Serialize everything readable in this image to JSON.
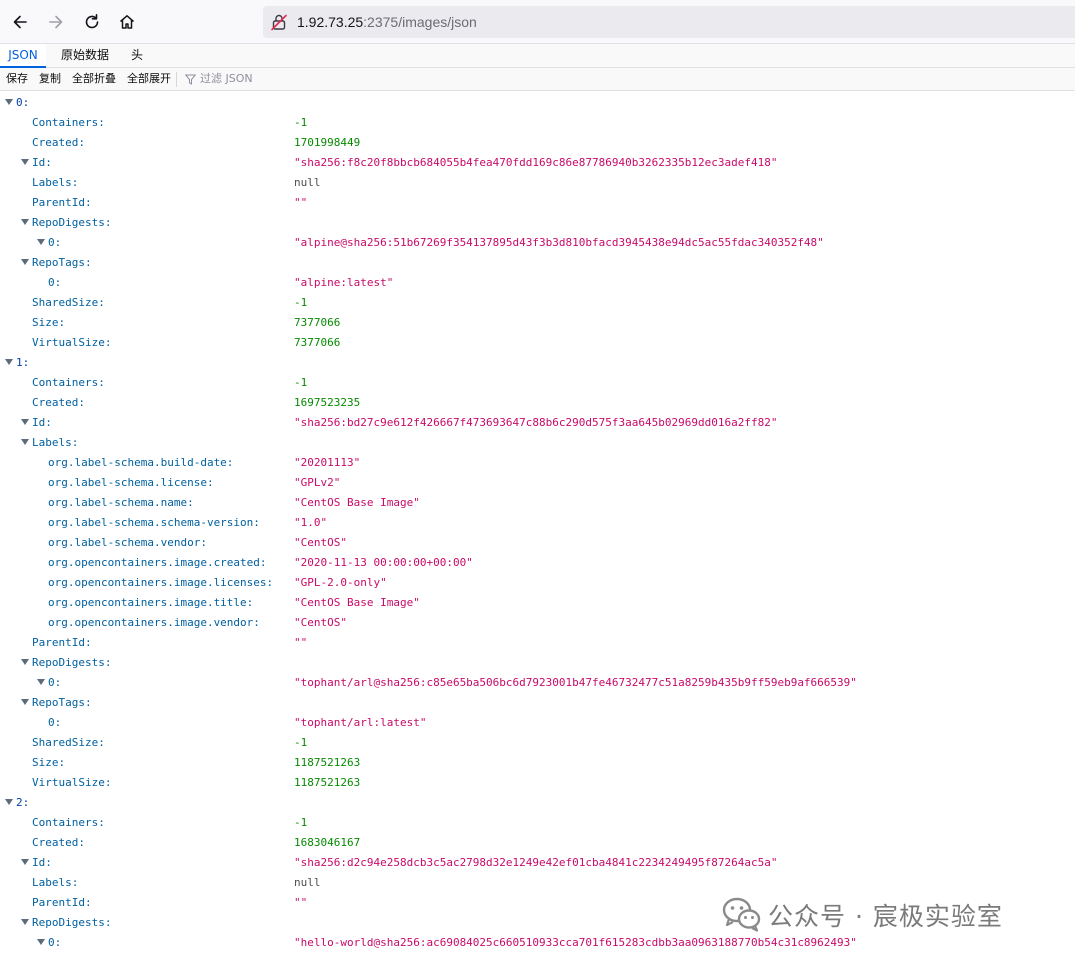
{
  "browser": {
    "url_host": "1.92.73.25",
    "url_rest": ":2375/images/json"
  },
  "viewer": {
    "tabs": [
      {
        "label": "JSON",
        "selected": true
      },
      {
        "label": "原始数据",
        "selected": false
      },
      {
        "label": "头",
        "selected": false
      }
    ],
    "toolbar": {
      "save": "保存",
      "copy": "复制",
      "collapse_all": "全部折叠",
      "expand_all": "全部展开",
      "filter_placeholder": "过滤 JSON"
    }
  },
  "colors": {
    "key": "#0060a0",
    "string": "#c80a68",
    "number": "#058b00",
    "null": "#4d4d4d",
    "accent": "#0060df"
  },
  "tree": [
    {
      "key": "0:",
      "level": 0,
      "type": "object",
      "expanded": true
    },
    {
      "key": "Containers:",
      "level": 1,
      "type": "number",
      "value": "-1"
    },
    {
      "key": "Created:",
      "level": 1,
      "type": "number",
      "value": "1701998449"
    },
    {
      "key": "Id:",
      "level": 1,
      "type": "string",
      "expanded": true,
      "value": "\"sha256:f8c20f8bbcb684055b4fea470fdd169c86e87786940b3262335b12ec3adef418\""
    },
    {
      "key": "Labels:",
      "level": 1,
      "type": "null",
      "value": "null"
    },
    {
      "key": "ParentId:",
      "level": 1,
      "type": "string",
      "value": "\"\""
    },
    {
      "key": "RepoDigests:",
      "level": 1,
      "type": "array",
      "expanded": true
    },
    {
      "key": "0:",
      "level": 2,
      "type": "string",
      "expanded": true,
      "value": "\"alpine@sha256:51b67269f354137895d43f3b3d810bfacd3945438e94dc5ac55fdac340352f48\""
    },
    {
      "key": "RepoTags:",
      "level": 1,
      "type": "array",
      "expanded": true
    },
    {
      "key": "0:",
      "level": 2,
      "type": "string",
      "value": "\"alpine:latest\""
    },
    {
      "key": "SharedSize:",
      "level": 1,
      "type": "number",
      "value": "-1"
    },
    {
      "key": "Size:",
      "level": 1,
      "type": "number",
      "value": "7377066"
    },
    {
      "key": "VirtualSize:",
      "level": 1,
      "type": "number",
      "value": "7377066"
    },
    {
      "key": "1:",
      "level": 0,
      "type": "object",
      "expanded": true
    },
    {
      "key": "Containers:",
      "level": 1,
      "type": "number",
      "value": "-1"
    },
    {
      "key": "Created:",
      "level": 1,
      "type": "number",
      "value": "1697523235"
    },
    {
      "key": "Id:",
      "level": 1,
      "type": "string",
      "expanded": true,
      "value": "\"sha256:bd27c9e612f426667f473693647c88b6c290d575f3aa645b02969dd016a2ff82\""
    },
    {
      "key": "Labels:",
      "level": 1,
      "type": "object",
      "expanded": true
    },
    {
      "key": "org.label-schema.build-date:",
      "level": 2,
      "type": "string",
      "value": "\"20201113\""
    },
    {
      "key": "org.label-schema.license:",
      "level": 2,
      "type": "string",
      "value": "\"GPLv2\""
    },
    {
      "key": "org.label-schema.name:",
      "level": 2,
      "type": "string",
      "value": "\"CentOS Base Image\""
    },
    {
      "key": "org.label-schema.schema-version:",
      "level": 2,
      "type": "string",
      "value": "\"1.0\""
    },
    {
      "key": "org.label-schema.vendor:",
      "level": 2,
      "type": "string",
      "value": "\"CentOS\""
    },
    {
      "key": "org.opencontainers.image.created:",
      "level": 2,
      "type": "string",
      "value": "\"2020-11-13 00:00:00+00:00\""
    },
    {
      "key": "org.opencontainers.image.licenses:",
      "level": 2,
      "type": "string",
      "value": "\"GPL-2.0-only\""
    },
    {
      "key": "org.opencontainers.image.title:",
      "level": 2,
      "type": "string",
      "value": "\"CentOS Base Image\""
    },
    {
      "key": "org.opencontainers.image.vendor:",
      "level": 2,
      "type": "string",
      "value": "\"CentOS\""
    },
    {
      "key": "ParentId:",
      "level": 1,
      "type": "string",
      "value": "\"\""
    },
    {
      "key": "RepoDigests:",
      "level": 1,
      "type": "array",
      "expanded": true
    },
    {
      "key": "0:",
      "level": 2,
      "type": "string",
      "expanded": true,
      "value": "\"tophant/arl@sha256:c85e65ba506bc6d7923001b47fe46732477c51a8259b435b9ff59eb9af666539\""
    },
    {
      "key": "RepoTags:",
      "level": 1,
      "type": "array",
      "expanded": true
    },
    {
      "key": "0:",
      "level": 2,
      "type": "string",
      "value": "\"tophant/arl:latest\""
    },
    {
      "key": "SharedSize:",
      "level": 1,
      "type": "number",
      "value": "-1"
    },
    {
      "key": "Size:",
      "level": 1,
      "type": "number",
      "value": "1187521263"
    },
    {
      "key": "VirtualSize:",
      "level": 1,
      "type": "number",
      "value": "1187521263"
    },
    {
      "key": "2:",
      "level": 0,
      "type": "object",
      "expanded": true
    },
    {
      "key": "Containers:",
      "level": 1,
      "type": "number",
      "value": "-1"
    },
    {
      "key": "Created:",
      "level": 1,
      "type": "number",
      "value": "1683046167"
    },
    {
      "key": "Id:",
      "level": 1,
      "type": "string",
      "expanded": true,
      "value": "\"sha256:d2c94e258dcb3c5ac2798d32e1249e42ef01cba4841c2234249495f87264ac5a\""
    },
    {
      "key": "Labels:",
      "level": 1,
      "type": "null",
      "value": "null"
    },
    {
      "key": "ParentId:",
      "level": 1,
      "type": "string",
      "value": "\"\""
    },
    {
      "key": "RepoDigests:",
      "level": 1,
      "type": "array",
      "expanded": true
    },
    {
      "key": "0:",
      "level": 2,
      "type": "string",
      "expanded": true,
      "value": "\"hello-world@sha256:ac69084025c660510933cca701f615283cdbb3aa0963188770b54c31c8962493\""
    }
  ],
  "watermark": {
    "text": "公众号 · 宸极实验室",
    "icon": "wechat-logo"
  }
}
